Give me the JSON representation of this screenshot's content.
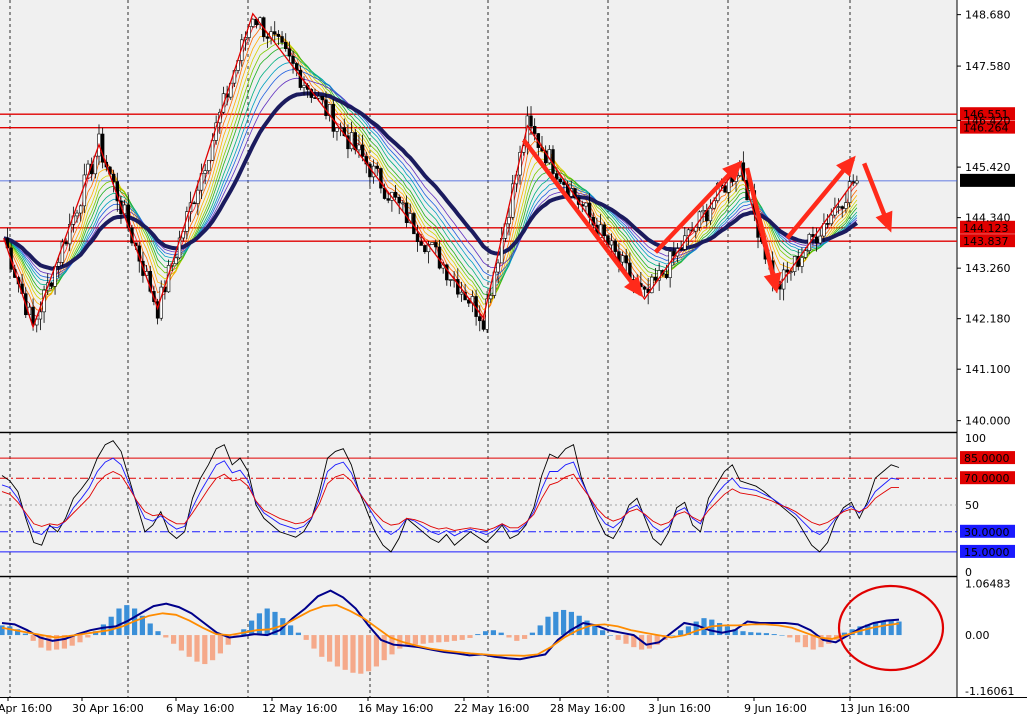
{
  "chart_data": [
    {
      "type": "candlestick",
      "panel": "price",
      "ylim": [
        139.8,
        148.95
      ],
      "y_ticks": [
        "148.680",
        "147.580",
        "146.420",
        "145.420",
        "144.340",
        "143.260",
        "142.180",
        "141.100",
        "140.000"
      ],
      "y_tick_values": [
        148.68,
        147.58,
        146.42,
        145.42,
        144.34,
        143.26,
        142.18,
        141.1,
        140.0
      ],
      "horizontal_lines": [
        {
          "value": 146.551,
          "label": "146.551",
          "color": "#e00000"
        },
        {
          "value": 146.264,
          "label": "146.264",
          "color": "#e00000"
        },
        {
          "value": 144.123,
          "label": "144.123",
          "color": "#e00000"
        },
        {
          "value": 143.837,
          "label": "143.837",
          "color": "#e00000"
        },
        {
          "value": 145.126,
          "label": "145.126",
          "color": "#3355dd",
          "current": true
        }
      ],
      "zigzag": [
        {
          "i": 0,
          "v": 143.9
        },
        {
          "i": 8,
          "v": 142.0
        },
        {
          "i": 26,
          "v": 145.9
        },
        {
          "i": 42,
          "v": 142.4
        },
        {
          "i": 68,
          "v": 148.7
        },
        {
          "i": 131,
          "v": 142.2
        },
        {
          "i": 143,
          "v": 146.3
        },
        {
          "i": 175,
          "v": 142.6
        },
        {
          "i": 201,
          "v": 145.5
        },
        {
          "i": 211,
          "v": 142.8
        },
        {
          "i": 232,
          "v": 145.1
        }
      ],
      "arrows": [
        {
          "from": [
            146.0,
            "i142"
          ],
          "to": [
            142.7,
            "i174"
          ]
        },
        {
          "from": [
            143.6,
            "i178"
          ],
          "to": [
            145.5,
            "i201"
          ]
        },
        {
          "from": [
            145.4,
            "i203"
          ],
          "to": [
            142.8,
            "i211"
          ]
        },
        {
          "from": [
            143.9,
            "i214"
          ],
          "to": [
            145.6,
            "i232"
          ]
        },
        {
          "from": [
            145.5,
            "i235"
          ],
          "to": [
            144.1,
            "i242"
          ]
        }
      ]
    },
    {
      "type": "line",
      "panel": "stochastic",
      "ylim": [
        0,
        100
      ],
      "y_ticks": [
        "100",
        "50",
        "0"
      ],
      "y_tick_values": [
        100,
        50,
        0
      ],
      "levels": [
        {
          "value": 85,
          "label": "85.0000",
          "color": "#e00000",
          "style": "solid"
        },
        {
          "value": 70,
          "label": "70.0000",
          "color": "#e00000",
          "style": "dashdot"
        },
        {
          "value": 30,
          "label": "30.0000",
          "color": "#1a1aff",
          "style": "dashdot"
        },
        {
          "value": 15,
          "label": "15.0000",
          "color": "#1a1aff",
          "style": "solid"
        }
      ],
      "series": [
        {
          "color": "#000000",
          "values": [
            72,
            68,
            60,
            40,
            22,
            20,
            35,
            30,
            40,
            55,
            62,
            70,
            85,
            95,
            98,
            90,
            70,
            50,
            30,
            35,
            45,
            30,
            25,
            30,
            55,
            70,
            80,
            92,
            95,
            80,
            85,
            75,
            50,
            40,
            35,
            30,
            28,
            26,
            30,
            40,
            60,
            85,
            90,
            92,
            80,
            60,
            45,
            30,
            20,
            15,
            25,
            40,
            35,
            30,
            25,
            22,
            28,
            20,
            25,
            30,
            26,
            22,
            28,
            35,
            25,
            28,
            35,
            48,
            72,
            88,
            85,
            92,
            95,
            70,
            55,
            40,
            28,
            25,
            35,
            50,
            55,
            40,
            25,
            20,
            30,
            48,
            52,
            35,
            30,
            55,
            65,
            75,
            80,
            68,
            66,
            64,
            60,
            55,
            50,
            45,
            40,
            30,
            20,
            15,
            22,
            38,
            48,
            52,
            40,
            52,
            70,
            75,
            80,
            78
          ]
        },
        {
          "color": "#1a1aff",
          "values": [
            65,
            63,
            55,
            42,
            30,
            28,
            34,
            33,
            38,
            48,
            55,
            63,
            75,
            82,
            85,
            80,
            66,
            52,
            40,
            38,
            42,
            36,
            32,
            34,
            48,
            60,
            70,
            80,
            83,
            74,
            76,
            68,
            52,
            44,
            40,
            36,
            34,
            32,
            34,
            40,
            55,
            75,
            80,
            82,
            74,
            60,
            50,
            40,
            32,
            28,
            32,
            40,
            38,
            34,
            30,
            28,
            31,
            27,
            30,
            32,
            30,
            28,
            31,
            36,
            30,
            31,
            36,
            45,
            62,
            75,
            75,
            80,
            82,
            68,
            56,
            44,
            36,
            33,
            38,
            47,
            50,
            42,
            34,
            30,
            34,
            45,
            48,
            40,
            36,
            50,
            58,
            65,
            70,
            63,
            62,
            61,
            58,
            55,
            51,
            47,
            43,
            37,
            31,
            28,
            32,
            40,
            46,
            49,
            44,
            50,
            60,
            65,
            70,
            69
          ]
        },
        {
          "color": "#e00000",
          "values": [
            60,
            58,
            52,
            44,
            36,
            34,
            36,
            35,
            38,
            44,
            50,
            56,
            66,
            72,
            75,
            72,
            63,
            53,
            45,
            42,
            43,
            39,
            36,
            36,
            44,
            53,
            62,
            70,
            73,
            68,
            69,
            64,
            53,
            46,
            43,
            40,
            38,
            36,
            37,
            41,
            51,
            66,
            71,
            73,
            68,
            59,
            51,
            44,
            38,
            35,
            36,
            40,
            39,
            37,
            34,
            32,
            33,
            31,
            32,
            33,
            32,
            31,
            33,
            36,
            33,
            33,
            37,
            43,
            55,
            65,
            67,
            71,
            73,
            64,
            56,
            47,
            41,
            38,
            40,
            45,
            47,
            43,
            38,
            35,
            37,
            43,
            45,
            41,
            38,
            46,
            52,
            58,
            62,
            59,
            58,
            57,
            55,
            53,
            50,
            48,
            45,
            41,
            37,
            35,
            37,
            41,
            45,
            47,
            45,
            48,
            55,
            59,
            63,
            63
          ]
        }
      ]
    },
    {
      "type": "bar",
      "panel": "macd",
      "ylim": [
        -1.22,
        1.14
      ],
      "y_ticks": [
        "1.06483",
        "0.00",
        "-1.16061"
      ],
      "y_tick_values": [
        1.06483,
        0.0,
        -1.16061
      ],
      "positive_color": "#3a8fd8",
      "negative_color": "#f5a98a",
      "histogram": [
        0.2,
        0.18,
        0.12,
        0.03,
        -0.12,
        -0.26,
        -0.32,
        -0.3,
        -0.28,
        -0.22,
        -0.15,
        -0.05,
        0.08,
        0.22,
        0.38,
        0.55,
        0.62,
        0.55,
        0.4,
        0.24,
        0.08,
        -0.05,
        -0.18,
        -0.32,
        -0.45,
        -0.55,
        -0.6,
        -0.52,
        -0.38,
        -0.2,
        -0.05,
        0.12,
        0.3,
        0.45,
        0.55,
        0.48,
        0.35,
        0.2,
        0.05,
        -0.1,
        -0.28,
        -0.45,
        -0.55,
        -0.65,
        -0.72,
        -0.78,
        -0.8,
        -0.75,
        -0.65,
        -0.52,
        -0.4,
        -0.28,
        -0.22,
        -0.2,
        -0.18,
        -0.16,
        -0.15,
        -0.14,
        -0.12,
        -0.1,
        -0.06,
        0.02,
        0.08,
        0.1,
        0.05,
        -0.05,
        -0.12,
        -0.08,
        0.05,
        0.2,
        0.38,
        0.48,
        0.52,
        0.48,
        0.4,
        0.3,
        0.2,
        0.1,
        0.0,
        -0.1,
        -0.18,
        -0.25,
        -0.3,
        -0.28,
        -0.2,
        -0.1,
        0.0,
        0.1,
        0.18,
        0.28,
        0.35,
        0.32,
        0.25,
        0.18,
        0.12,
        0.08,
        0.06,
        0.05,
        0.04,
        0.02,
        0.0,
        -0.05,
        -0.15,
        -0.25,
        -0.3,
        -0.25,
        -0.18,
        -0.1,
        0.05,
        0.12,
        0.18,
        0.22,
        0.26,
        0.28,
        0.3,
        0.28
      ],
      "series": [
        {
          "color": "#00008b",
          "values": [
            0.25,
            0.22,
            0.1,
            -0.05,
            -0.12,
            -0.08,
            0.02,
            0.1,
            0.15,
            0.18,
            0.3,
            0.45,
            0.6,
            0.65,
            0.58,
            0.45,
            0.25,
            0.05,
            -0.05,
            -0.02,
            0.02,
            0.0,
            0.1,
            0.35,
            0.55,
            0.8,
            0.92,
            0.78,
            0.55,
            0.2,
            -0.1,
            -0.2,
            -0.22,
            -0.25,
            -0.3,
            -0.35,
            -0.38,
            -0.42,
            -0.4,
            -0.45,
            -0.48,
            -0.5,
            -0.45,
            -0.4,
            -0.1,
            0.1,
            0.25,
            0.2,
            0.1,
            0.05,
            0.0,
            -0.2,
            -0.15,
            0.05,
            0.25,
            0.2,
            0.1,
            0.05,
            0.1,
            0.28,
            0.25,
            0.25,
            0.25,
            0.22,
            0.1,
            -0.1,
            -0.15,
            0.0,
            0.15,
            0.25,
            0.3,
            0.32
          ]
        },
        {
          "color": "#ff8c00",
          "values": [
            0.15,
            0.1,
            0.05,
            0.0,
            -0.05,
            -0.02,
            0.02,
            0.06,
            0.1,
            0.18,
            0.3,
            0.4,
            0.45,
            0.42,
            0.3,
            0.15,
            0.02,
            0.0,
            0.05,
            0.1,
            0.12,
            0.2,
            0.35,
            0.5,
            0.6,
            0.62,
            0.5,
            0.35,
            0.15,
            -0.05,
            -0.15,
            -0.22,
            -0.28,
            -0.32,
            -0.35,
            -0.38,
            -0.4,
            -0.42,
            -0.42,
            -0.43,
            -0.4,
            -0.25,
            -0.05,
            0.1,
            0.2,
            0.22,
            0.18,
            0.1,
            0.05,
            0.0,
            -0.05,
            0.0,
            0.1,
            0.18,
            0.2,
            0.2,
            0.22,
            0.22,
            0.2,
            0.15,
            0.05,
            -0.05,
            -0.08,
            0.0,
            0.08,
            0.15,
            0.2,
            0.24
          ]
        }
      ]
    }
  ],
  "x_labels": [
    "Apr 16:00",
    "30 Apr 16:00",
    "6 May 16:00",
    "12 May 16:00",
    "16 May 16:00",
    "22 May 16:00",
    "28 May 16:00",
    "3 Jun 16:00",
    "9 Jun 16:00",
    "13 Jun 16:00"
  ],
  "colors": {
    "background": "#ffffff",
    "grid_dots": "#000000",
    "bull": "#2b8a3e",
    "bear": "#d42020",
    "ma_thick": "#1b1b5e"
  }
}
